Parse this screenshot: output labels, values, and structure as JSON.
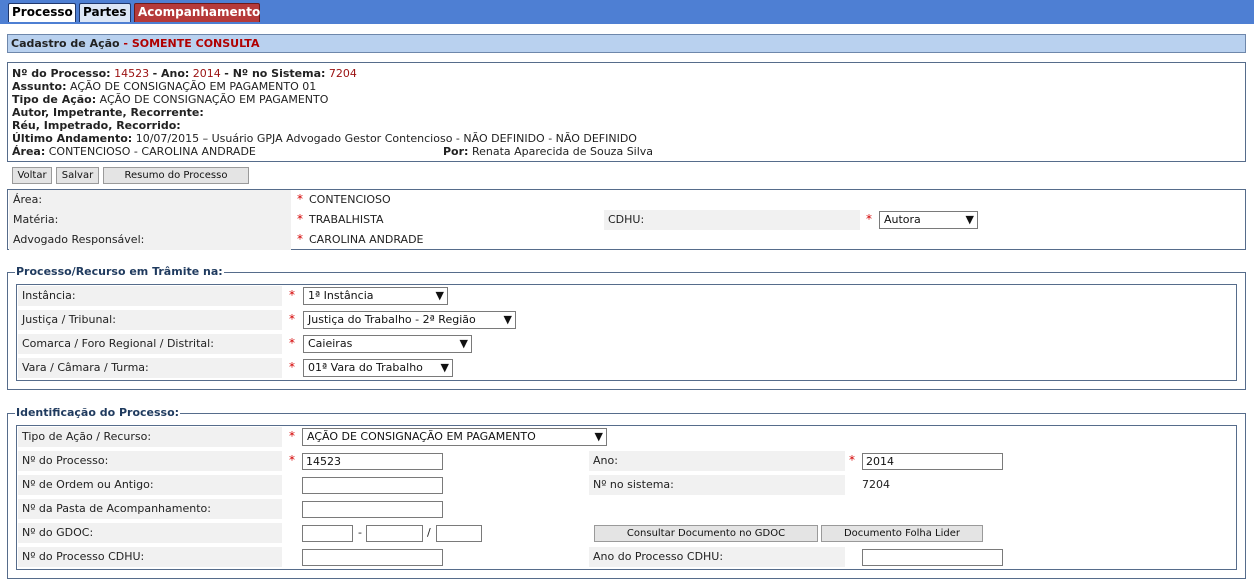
{
  "tabs": [
    {
      "label": "Processo"
    },
    {
      "label": "Partes"
    },
    {
      "label": "Acompanhamento"
    }
  ],
  "title": {
    "main": "Cadastro de Ação",
    "sep": " - ",
    "mode": "SOMENTE CONSULTA"
  },
  "info": {
    "processo_label": "Nº do Processo:",
    "processo_value": "14523",
    "ano_label": "Ano:",
    "ano_value": "2014",
    "sistema_label": "Nº no Sistema:",
    "sistema_value": "7204",
    "assunto_label": "Assunto:",
    "assunto_value": "AÇÃO DE CONSIGNAÇÃO EM PAGAMENTO 01",
    "tipo_label": "Tipo de Ação:",
    "tipo_value": "AÇÃO DE CONSIGNAÇÃO EM PAGAMENTO",
    "autor_label": "Autor, Impetrante, Recorrente:",
    "reu_label": "Réu, Impetrado, Recorrido:",
    "andamento_label": "Último Andamento:",
    "andamento_value": "10/07/2015 – Usuário GPJA Advogado Gestor Contencioso - NÃO DEFINIDO - NÃO DEFINIDO",
    "area_label": "Área:",
    "area_value": "CONTENCIOSO - CAROLINA ANDRADE",
    "por_label": "Por:",
    "por_value": "Renata Aparecida de Souza Silva"
  },
  "buttons": {
    "voltar": "Voltar",
    "salvar": "Salvar",
    "resumo": "Resumo do Processo"
  },
  "general": {
    "area_label": "Área:",
    "area_value": "CONTENCIOSO",
    "materia_label": "Matéria:",
    "materia_value": "TRABALHISTA",
    "cdhu_label": "CDHU:",
    "cdhu_value": "Autora",
    "advogado_label": "Advogado Responsável:",
    "advogado_value": "CAROLINA ANDRADE",
    "required_mark": "*"
  },
  "tramite": {
    "legend": "Processo/Recurso em Trâmite na:",
    "instancia_label": "Instância:",
    "instancia_value": "1ª Instância",
    "justica_label": "Justiça / Tribunal:",
    "justica_value": "Justiça do Trabalho - 2ª Região",
    "comarca_label": "Comarca / Foro Regional / Distrital:",
    "comarca_value": "Caieiras",
    "vara_label": "Vara / Câmara / Turma:",
    "vara_value": "01ª Vara do Trabalho"
  },
  "identificacao": {
    "legend": "Identificação do Processo:",
    "tipo_label": "Tipo de Ação / Recurso:",
    "tipo_value": "AÇÃO DE CONSIGNAÇÃO EM PAGAMENTO",
    "processo_label": "Nº do Processo:",
    "processo_value": "14523",
    "ano_label": "Ano:",
    "ano_value": "2014",
    "ordem_label": "Nº de Ordem ou Antigo:",
    "ordem_value": "",
    "sistema_label": "Nº no sistema:",
    "sistema_value": "7204",
    "pasta_label": "Nº da Pasta de Acompanhamento:",
    "pasta_value": "",
    "gdoc_label": "Nº do GDOC:",
    "gdoc_sep1": "-",
    "gdoc_sep2": "/",
    "consultar_btn": "Consultar Documento no GDOC",
    "folha_btn": "Documento Folha Lider",
    "cdhu_processo_label": "Nº do Processo CDHU:",
    "cdhu_ano_label": "Ano do Processo CDHU:"
  },
  "icons": {
    "dropdown": "chevron-down-icon"
  },
  "colors": {
    "tabbar": "#4e7fd3",
    "titlebar": "#b9d1ef",
    "required": "#d40000",
    "highlight": "#b00000"
  }
}
